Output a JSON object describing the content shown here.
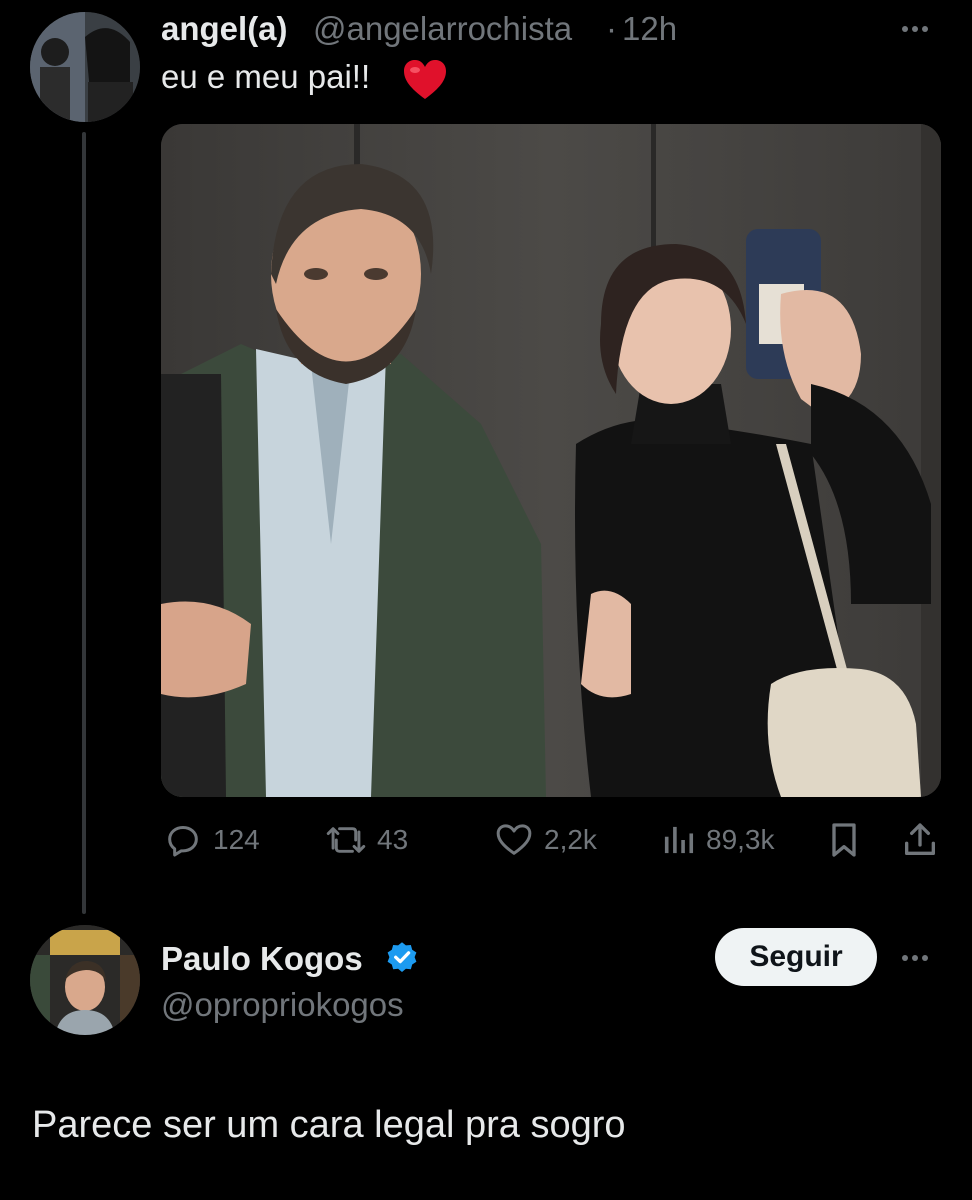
{
  "tweet": {
    "author_name": "angel(a)",
    "author_handle": "@angelarrochista",
    "separator": "·",
    "time": "12h",
    "text": "eu e meu pai!!",
    "emoji": "heart-emoji",
    "actions": {
      "replies": "124",
      "retweets": "43",
      "likes": "2,2k",
      "views": "89,3k"
    }
  },
  "reply": {
    "author_name": "Paulo Kogos",
    "author_handle": "@opropriokogos",
    "verified": true,
    "follow_label": "Seguir",
    "text": "Parece ser um cara legal pra sogro"
  },
  "colors": {
    "background": "#000000",
    "primary_text": "#e7e9ea",
    "secondary_text": "#71767b",
    "verified_blue": "#1d9bf0",
    "heart_red": "#e0112b",
    "follow_button_bg": "#eff3f4"
  }
}
